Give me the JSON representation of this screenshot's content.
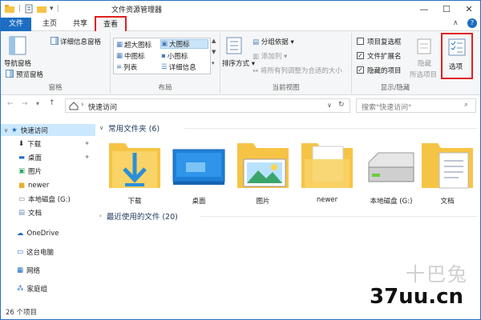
{
  "window": {
    "title": "文件资源管理器"
  },
  "tabs": [
    {
      "label": "文件"
    },
    {
      "label": "主页"
    },
    {
      "label": "共享"
    },
    {
      "label": "查看"
    }
  ],
  "ribbon": {
    "panes": {
      "nav_pane": "导航窗格",
      "preview_pane": "预览窗格",
      "details_pane": "详细信息窗格",
      "group_label": "窗格"
    },
    "layout": {
      "items": [
        "超大图标",
        "大图标",
        "中图标",
        "小图标",
        "列表",
        "详细信息"
      ],
      "selected": "大图标",
      "group_label": "布局"
    },
    "current_view": {
      "sort_by": "排序方式",
      "group_by": "分组依据",
      "add_column": "添加列",
      "fit_columns": "将所有列调整为合适的大小",
      "group_label": "当前视图"
    },
    "show_hide": {
      "item_checkbox": "项目复选框",
      "file_ext": "文件扩展名",
      "hidden_items": "隐藏的项目",
      "hide": "隐藏",
      "selected_items": "所选项目",
      "group_label": "显示/隐藏",
      "checked": {
        "item_checkbox": false,
        "file_ext": true,
        "hidden_items": true
      }
    },
    "options": "选项"
  },
  "address": {
    "path": "快速访问",
    "search_placeholder": "搜索\"快速访问\""
  },
  "nav": {
    "items": [
      "快速访问",
      "下载",
      "桌面",
      "图片",
      "newer",
      "本地磁盘 (G:)",
      "文档",
      "OneDrive",
      "这台电脑",
      "网络",
      "家庭组"
    ]
  },
  "content": {
    "frequent_header": "常用文件夹 (6)",
    "recent_header": "最近使用的文件 (20)",
    "folders": [
      "下载",
      "桌面",
      "图片",
      "newer",
      "本地磁盘 (G:)",
      "文档"
    ]
  },
  "status": {
    "count": "26 个项目"
  },
  "watermark": {
    "mark": "十巴兔",
    "site": "37uu.cn"
  },
  "colors": {
    "accent": "#1b6ec2",
    "highlight": "#e02020",
    "selection": "#cce8ff",
    "folder": "#f6c445"
  }
}
